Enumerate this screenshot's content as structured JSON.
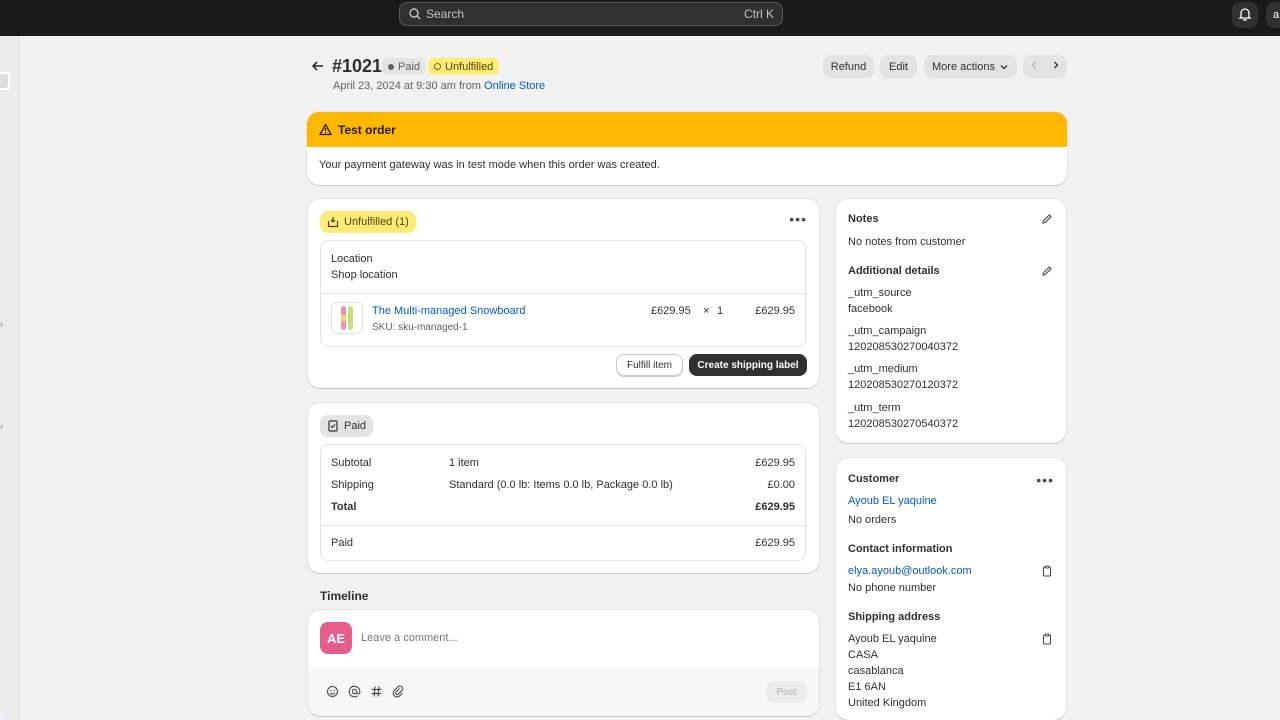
{
  "topbar": {
    "search_placeholder": "Search",
    "search_shortcut": "Ctrl K",
    "avatar_initial": "a"
  },
  "header": {
    "order_id": "#1021",
    "payment_badge": "Paid",
    "fulfillment_badge": "Unfulfilled",
    "date_prefix": "April 23, 2024 at 9:30 am from ",
    "channel": "Online Store",
    "actions": {
      "refund": "Refund",
      "edit": "Edit",
      "more": "More actions"
    }
  },
  "test_order": {
    "title": "Test order",
    "message": "Your payment gateway was in test mode when this order was created."
  },
  "fulfillment": {
    "status_label": "Unfulfilled (1)",
    "location_label": "Location",
    "location_value": "Shop location",
    "item": {
      "name": "The Multi-managed Snowboard",
      "sku": "SKU: sku-managed-1",
      "price": "£629.95",
      "times": "×",
      "qty": "1",
      "total": "£629.95"
    },
    "fulfill_button": "Fulfill item",
    "label_button": "Create shipping label"
  },
  "payment": {
    "status_label": "Paid",
    "subtotal_label": "Subtotal",
    "subtotal_desc": "1 item",
    "subtotal_value": "£629.95",
    "shipping_label": "Shipping",
    "shipping_desc": "Standard (0.0 lb: Items 0.0 lb, Package 0.0 lb)",
    "shipping_value": "£0.00",
    "total_label": "Total",
    "total_value": "£629.95",
    "paid_label": "Paid",
    "paid_value": "£629.95"
  },
  "timeline": {
    "title": "Timeline",
    "avatar_initials": "AE",
    "comment_placeholder": "Leave a comment...",
    "post_button": "Post"
  },
  "notes": {
    "title": "Notes",
    "value": "No notes from customer",
    "additional_title": "Additional details",
    "details": [
      {
        "key": "_utm_source",
        "value": "facebook"
      },
      {
        "key": "_utm_campaign",
        "value": "120208530270040372"
      },
      {
        "key": "_utm_medium",
        "value": "120208530270120372"
      },
      {
        "key": "_utm_term",
        "value": "120208530270540372"
      }
    ]
  },
  "customer": {
    "title": "Customer",
    "name": "Ayoub EL yaquine",
    "orders": "No orders",
    "contact_title": "Contact information",
    "email": "elya.ayoub@outlook.com",
    "phone": "No phone number",
    "shipping_title": "Shipping address",
    "address": [
      "Ayoub EL yaquine",
      "CASA",
      "casablanca",
      "E1 6AN",
      "United Kingdom"
    ]
  },
  "colors": {
    "accent_link": "#005bd3",
    "warning_banner": "#ffb800",
    "unfulfilled_badge": "#ffeb78",
    "avatar": "#e65c8a"
  }
}
